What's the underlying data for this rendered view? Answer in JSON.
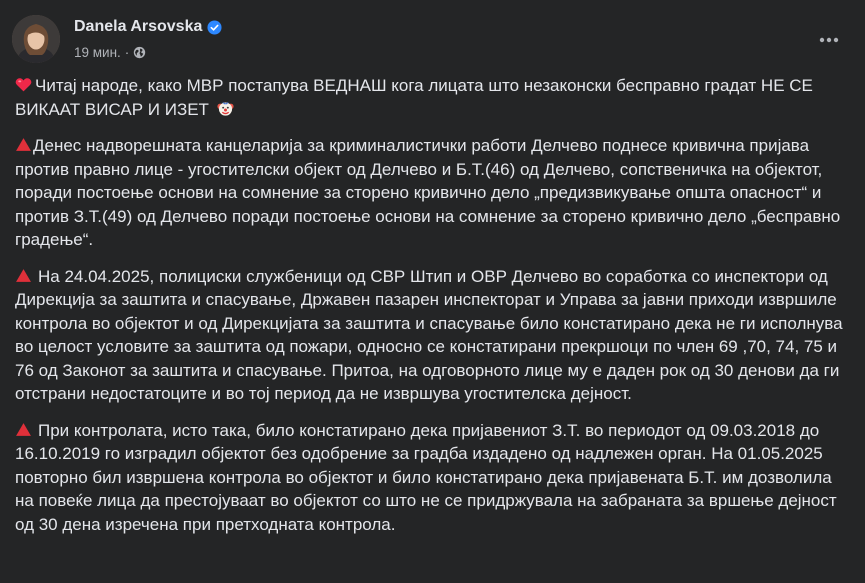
{
  "post": {
    "author": "Danela Arsovska",
    "time": "19 мин.",
    "separator": "·",
    "paragraphs": [
      {
        "emoji": "red-heart",
        "text": "Читај народе, како МВР постапува ВЕДНАШ кога лицата што незаконски бесправно градат НЕ СЕ ВИКААТ ВИСАР И ИЗЕТ",
        "trailing_emoji": "clown-face"
      },
      {
        "emoji": "red-triangle",
        "text": "Денес надворешната канцеларија за криминалистички работи Делчево поднесе кривична пријава против правно лице - угостителски објект од Делчево и Б.Т.(46) од Делчево, сопственичка на објектот, поради постоење основи на сомнение за сторено кривично дело „предизвикување општа опасност“ и против З.Т.(49) од Делчево поради постоење основи на сомнение за сторено кривично дело „бесправно градење“."
      },
      {
        "emoji": "red-triangle",
        "text": "На 24.04.2025, полициски службеници од СВР Штип и ОВР Делчево во соработка со инспектори од Дирекција за заштита и спасување, Државен пазарен инспекторат  и Управа за јавни приходи извршиле контрола во објектот и од Дирекцијата за заштита и спасување било констатирано дека не ги исполнува во целост условите за заштита од пожари, односно се констатирани прекршоци по член 69 ,70, 74, 75 и 76 од Законот за заштита и спасување. Притоа, на одговорното лице му е даден рок од 30 денови да ги отстрани недостатоците и во тој период да не извршува угостителска дејност."
      },
      {
        "emoji": "red-triangle",
        "text": "При контролата, исто така, било констатирано дека пријавениот З.Т. во периодот од 09.03.2018 до 16.10.2019 го изградил објектот без одобрение за градба издадено од надлежен орган. На 01.05.2025 повторно бил извршена контрола во објектот и било констатирано дека пријавената Б.Т. им дозволила на повеќе лица да престојуваат во објектот со што не се придржувала на забраната за вршење дејност од 30 дена изречена при претходната контрола."
      }
    ]
  },
  "colors": {
    "background": "#242526",
    "text": "#e4e6eb",
    "secondary_text": "#b0b3b8",
    "verified_blue": "#2d88ff",
    "heart_red": "#f02849",
    "triangle_red": "#e0303a"
  },
  "icons": {
    "verified": "verified-badge-icon",
    "privacy": "globe-icon",
    "more": "more-options-icon"
  }
}
